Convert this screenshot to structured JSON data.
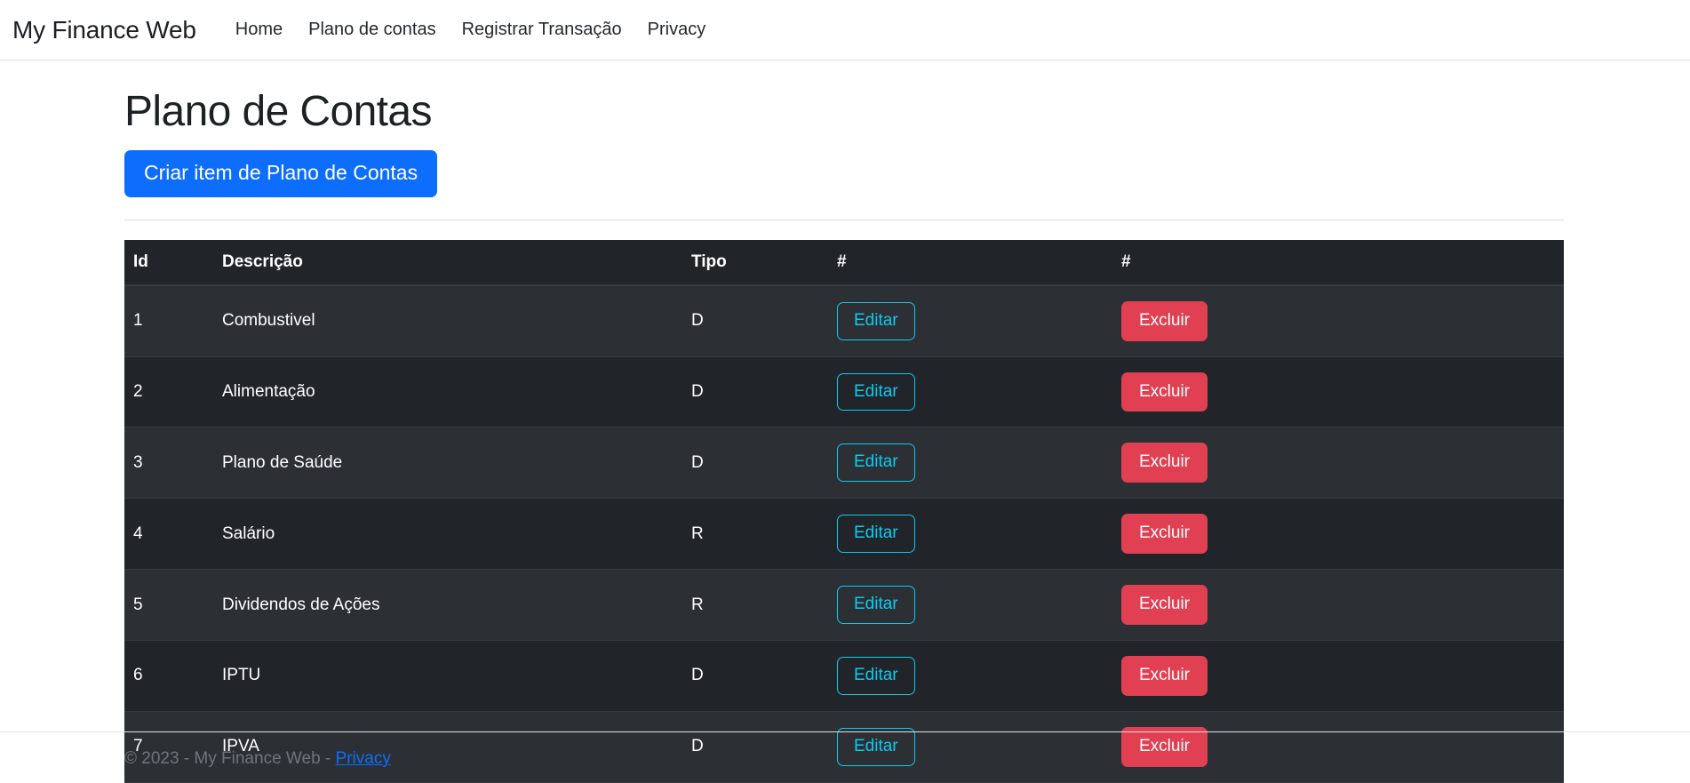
{
  "navbar": {
    "brand": "My Finance Web",
    "links": [
      {
        "label": "Home"
      },
      {
        "label": "Plano de contas"
      },
      {
        "label": "Registrar Transação"
      },
      {
        "label": "Privacy"
      }
    ]
  },
  "main": {
    "title": "Plano de Contas",
    "create_button": "Criar item de Plano de Contas",
    "table": {
      "headers": [
        "Id",
        "Descrição",
        "Tipo",
        "#",
        "#"
      ],
      "rows": [
        {
          "id": "1",
          "descricao": "Combustivel",
          "tipo": "D",
          "edit": "Editar",
          "delete": "Excluir"
        },
        {
          "id": "2",
          "descricao": "Alimentação",
          "tipo": "D",
          "edit": "Editar",
          "delete": "Excluir"
        },
        {
          "id": "3",
          "descricao": "Plano de Saúde",
          "tipo": "D",
          "edit": "Editar",
          "delete": "Excluir"
        },
        {
          "id": "4",
          "descricao": "Salário",
          "tipo": "R",
          "edit": "Editar",
          "delete": "Excluir"
        },
        {
          "id": "5",
          "descricao": "Dividendos de Ações",
          "tipo": "R",
          "edit": "Editar",
          "delete": "Excluir"
        },
        {
          "id": "6",
          "descricao": "IPTU",
          "tipo": "D",
          "edit": "Editar",
          "delete": "Excluir"
        },
        {
          "id": "7",
          "descricao": "IPVA",
          "tipo": "D",
          "edit": "Editar",
          "delete": "Excluir"
        }
      ]
    }
  },
  "footer": {
    "text": "© 2023 - My Finance Web - ",
    "link": "Privacy"
  },
  "colors": {
    "primary": "#0d6efd",
    "danger": "#e13f52",
    "info": "#0dcaf0",
    "table_dark": "#212529",
    "table_stripe": "#2c3034",
    "link": "#0d6efd",
    "muted": "#6c757d"
  }
}
